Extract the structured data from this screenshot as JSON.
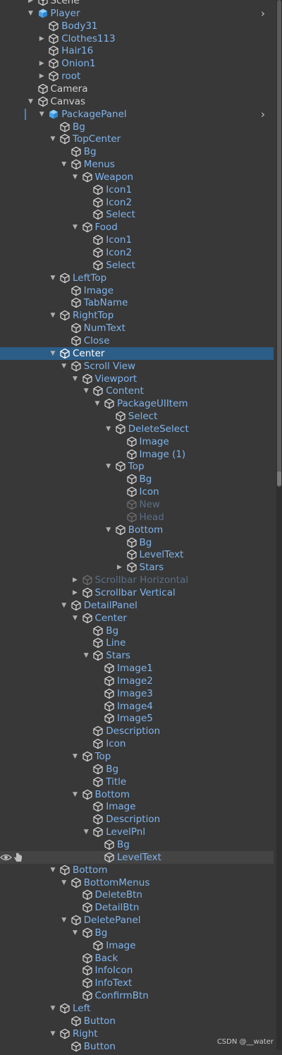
{
  "hierarchy": [
    {
      "label": "Scene",
      "depth": 2,
      "expand": "collapsed",
      "kind": "normal"
    },
    {
      "label": "Player",
      "depth": 2,
      "expand": "expanded",
      "kind": "prefab-root",
      "chevron": true
    },
    {
      "label": "Body31",
      "depth": 3,
      "expand": "none",
      "kind": "prefab"
    },
    {
      "label": "Clothes113",
      "depth": 3,
      "expand": "collapsed",
      "kind": "prefab"
    },
    {
      "label": "Hair16",
      "depth": 3,
      "expand": "none",
      "kind": "prefab"
    },
    {
      "label": "Onion1",
      "depth": 3,
      "expand": "collapsed",
      "kind": "prefab"
    },
    {
      "label": "root",
      "depth": 3,
      "expand": "collapsed",
      "kind": "prefab"
    },
    {
      "label": "Camera",
      "depth": 2,
      "expand": "none",
      "kind": "normal"
    },
    {
      "label": "Canvas",
      "depth": 2,
      "expand": "expanded",
      "kind": "normal"
    },
    {
      "label": "PackagePanel",
      "depth": 3,
      "expand": "expanded",
      "kind": "prefab-root",
      "chevron": true,
      "marker": true
    },
    {
      "label": "Bg",
      "depth": 4,
      "expand": "none",
      "kind": "prefab"
    },
    {
      "label": "TopCenter",
      "depth": 4,
      "expand": "expanded",
      "kind": "prefab"
    },
    {
      "label": "Bg",
      "depth": 5,
      "expand": "none",
      "kind": "prefab"
    },
    {
      "label": "Menus",
      "depth": 5,
      "expand": "expanded",
      "kind": "prefab"
    },
    {
      "label": "Weapon",
      "depth": 6,
      "expand": "expanded",
      "kind": "prefab"
    },
    {
      "label": "Icon1",
      "depth": 7,
      "expand": "none",
      "kind": "prefab"
    },
    {
      "label": "Icon2",
      "depth": 7,
      "expand": "none",
      "kind": "prefab"
    },
    {
      "label": "Select",
      "depth": 7,
      "expand": "none",
      "kind": "prefab"
    },
    {
      "label": "Food",
      "depth": 6,
      "expand": "expanded",
      "kind": "prefab"
    },
    {
      "label": "Icon1",
      "depth": 7,
      "expand": "none",
      "kind": "prefab"
    },
    {
      "label": "Icon2",
      "depth": 7,
      "expand": "none",
      "kind": "prefab"
    },
    {
      "label": "Select",
      "depth": 7,
      "expand": "none",
      "kind": "prefab"
    },
    {
      "label": "LeftTop",
      "depth": 4,
      "expand": "expanded",
      "kind": "prefab"
    },
    {
      "label": "Image",
      "depth": 5,
      "expand": "none",
      "kind": "prefab"
    },
    {
      "label": "TabName",
      "depth": 5,
      "expand": "none",
      "kind": "prefab"
    },
    {
      "label": "RightTop",
      "depth": 4,
      "expand": "expanded",
      "kind": "prefab"
    },
    {
      "label": "NumText",
      "depth": 5,
      "expand": "none",
      "kind": "prefab"
    },
    {
      "label": "Close",
      "depth": 5,
      "expand": "none",
      "kind": "prefab"
    },
    {
      "label": "Center",
      "depth": 4,
      "expand": "expanded",
      "kind": "prefab",
      "selected": true
    },
    {
      "label": "Scroll View",
      "depth": 5,
      "expand": "expanded",
      "kind": "prefab"
    },
    {
      "label": "Viewport",
      "depth": 6,
      "expand": "expanded",
      "kind": "prefab"
    },
    {
      "label": "Content",
      "depth": 7,
      "expand": "expanded",
      "kind": "prefab"
    },
    {
      "label": "PackageUIItem",
      "depth": 8,
      "expand": "expanded",
      "kind": "prefab"
    },
    {
      "label": "Select",
      "depth": 9,
      "expand": "none",
      "kind": "prefab"
    },
    {
      "label": "DeleteSelect",
      "depth": 9,
      "expand": "expanded",
      "kind": "prefab"
    },
    {
      "label": "Image",
      "depth": 10,
      "expand": "none",
      "kind": "prefab"
    },
    {
      "label": "Image (1)",
      "depth": 10,
      "expand": "none",
      "kind": "prefab"
    },
    {
      "label": "Top",
      "depth": 9,
      "expand": "expanded",
      "kind": "prefab"
    },
    {
      "label": "Bg",
      "depth": 10,
      "expand": "none",
      "kind": "prefab"
    },
    {
      "label": "Icon",
      "depth": 10,
      "expand": "none",
      "kind": "prefab"
    },
    {
      "label": "New",
      "depth": 10,
      "expand": "none",
      "kind": "disabled"
    },
    {
      "label": "Head",
      "depth": 10,
      "expand": "none",
      "kind": "disabled"
    },
    {
      "label": "Bottom",
      "depth": 9,
      "expand": "expanded",
      "kind": "prefab"
    },
    {
      "label": "Bg",
      "depth": 10,
      "expand": "none",
      "kind": "prefab"
    },
    {
      "label": "LevelText",
      "depth": 10,
      "expand": "none",
      "kind": "prefab"
    },
    {
      "label": "Stars",
      "depth": 10,
      "expand": "collapsed",
      "kind": "prefab"
    },
    {
      "label": "Scrollbar Horizontal",
      "depth": 6,
      "expand": "collapsed",
      "kind": "disabled"
    },
    {
      "label": "Scrollbar Vertical",
      "depth": 6,
      "expand": "collapsed",
      "kind": "prefab"
    },
    {
      "label": "DetailPanel",
      "depth": 5,
      "expand": "expanded",
      "kind": "prefab"
    },
    {
      "label": "Center",
      "depth": 6,
      "expand": "expanded",
      "kind": "prefab"
    },
    {
      "label": "Bg",
      "depth": 7,
      "expand": "none",
      "kind": "prefab"
    },
    {
      "label": "Line",
      "depth": 7,
      "expand": "none",
      "kind": "prefab"
    },
    {
      "label": "Stars",
      "depth": 7,
      "expand": "expanded",
      "kind": "prefab"
    },
    {
      "label": "Image1",
      "depth": 8,
      "expand": "none",
      "kind": "prefab"
    },
    {
      "label": "Image2",
      "depth": 8,
      "expand": "none",
      "kind": "prefab"
    },
    {
      "label": "Image3",
      "depth": 8,
      "expand": "none",
      "kind": "prefab"
    },
    {
      "label": "Image4",
      "depth": 8,
      "expand": "none",
      "kind": "prefab"
    },
    {
      "label": "Image5",
      "depth": 8,
      "expand": "none",
      "kind": "prefab"
    },
    {
      "label": "Description",
      "depth": 7,
      "expand": "none",
      "kind": "prefab"
    },
    {
      "label": "Icon",
      "depth": 7,
      "expand": "none",
      "kind": "prefab"
    },
    {
      "label": "Top",
      "depth": 6,
      "expand": "expanded",
      "kind": "prefab"
    },
    {
      "label": "Bg",
      "depth": 7,
      "expand": "none",
      "kind": "prefab"
    },
    {
      "label": "Title",
      "depth": 7,
      "expand": "none",
      "kind": "prefab"
    },
    {
      "label": "Bottom",
      "depth": 6,
      "expand": "expanded",
      "kind": "prefab"
    },
    {
      "label": "Image",
      "depth": 7,
      "expand": "none",
      "kind": "prefab"
    },
    {
      "label": "Description",
      "depth": 7,
      "expand": "none",
      "kind": "prefab"
    },
    {
      "label": "LevelPnl",
      "depth": 7,
      "expand": "expanded",
      "kind": "prefab"
    },
    {
      "label": "Bg",
      "depth": 8,
      "expand": "none",
      "kind": "prefab"
    },
    {
      "label": "LevelText",
      "depth": 8,
      "expand": "none",
      "kind": "prefab",
      "hovered": true
    },
    {
      "label": "Bottom",
      "depth": 4,
      "expand": "expanded",
      "kind": "prefab"
    },
    {
      "label": "BottomMenus",
      "depth": 5,
      "expand": "expanded",
      "kind": "prefab"
    },
    {
      "label": "DeleteBtn",
      "depth": 6,
      "expand": "none",
      "kind": "prefab"
    },
    {
      "label": "DetailBtn",
      "depth": 6,
      "expand": "none",
      "kind": "prefab"
    },
    {
      "label": "DeletePanel",
      "depth": 5,
      "expand": "expanded",
      "kind": "prefab"
    },
    {
      "label": "Bg",
      "depth": 6,
      "expand": "expanded",
      "kind": "prefab"
    },
    {
      "label": "Image",
      "depth": 7,
      "expand": "none",
      "kind": "prefab"
    },
    {
      "label": "Back",
      "depth": 6,
      "expand": "none",
      "kind": "prefab"
    },
    {
      "label": "InfoIcon",
      "depth": 6,
      "expand": "none",
      "kind": "prefab"
    },
    {
      "label": "InfoText",
      "depth": 6,
      "expand": "none",
      "kind": "prefab"
    },
    {
      "label": "ConfirmBtn",
      "depth": 6,
      "expand": "none",
      "kind": "prefab"
    },
    {
      "label": "Left",
      "depth": 4,
      "expand": "expanded",
      "kind": "prefab"
    },
    {
      "label": "Button",
      "depth": 5,
      "expand": "none",
      "kind": "prefab"
    },
    {
      "label": "Right",
      "depth": 4,
      "expand": "expanded",
      "kind": "prefab"
    },
    {
      "label": "Button",
      "depth": 5,
      "expand": "none",
      "kind": "prefab"
    }
  ],
  "watermark": "CSDN @__water",
  "colors": {
    "background": "#383838",
    "selection": "#2c5d87",
    "prefab_text": "#7fb4ec",
    "normal_text": "#d2d2d2",
    "disabled_text": "#5b6f88",
    "prefab_icon": "#63b3f0"
  },
  "icons": {
    "expanded": "triangle-down",
    "collapsed": "triangle-right",
    "gameobject": "cube-outline-icon",
    "prefab_root": "blue-cube-icon",
    "visibility": "eye-icon",
    "pickability": "hand-icon",
    "children_arrow": "chevron-right-icon"
  }
}
